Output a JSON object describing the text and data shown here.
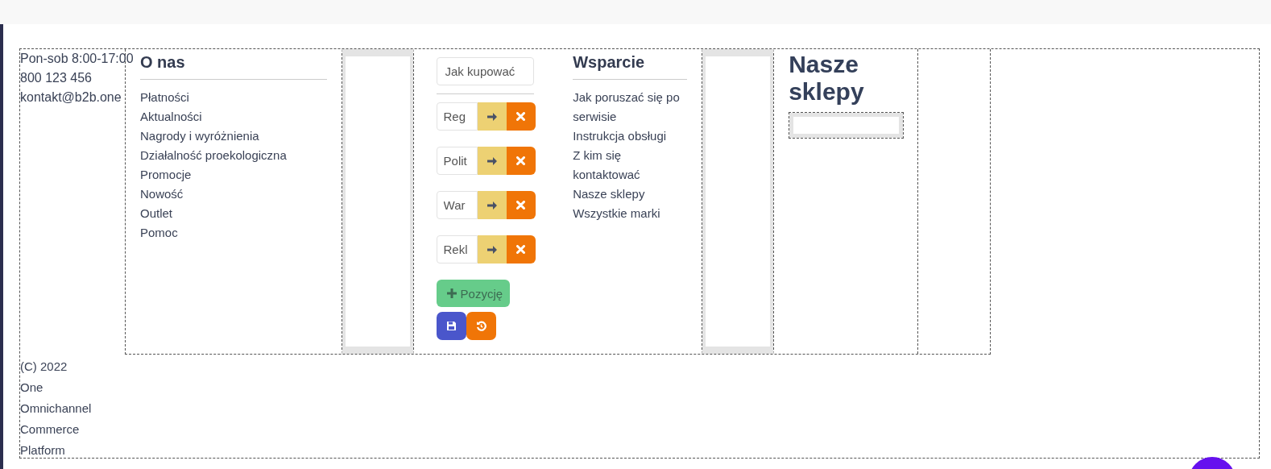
{
  "contact": [
    "Pon-sob 8:00-17:00",
    "800 123 456",
    "kontakt@b2b.one"
  ],
  "about": {
    "title": "O nas",
    "links": [
      "Płatności",
      "Aktualności",
      "Nagrody i wyróżnienia",
      "Działalność proekologiczna",
      "Promocje",
      "Nowość",
      "Outlet",
      "Pomoc"
    ]
  },
  "editor": {
    "main_field": {
      "value": "Jak kupować"
    },
    "items": [
      {
        "value": "Reg"
      },
      {
        "value": "Polit"
      },
      {
        "value": "War"
      },
      {
        "value": "Rekl"
      }
    ],
    "add_button": "Pozycję"
  },
  "support": {
    "title": "Wsparcie",
    "links": [
      "Jak poruszać się po serwisie",
      "Instrukcja obsługi",
      "Z kim się kontaktować",
      "Nasze sklepy",
      "Wszystkie marki"
    ]
  },
  "stores": {
    "title": "Nasze sklepy"
  },
  "copyright": "(C) 2022 One Omnichannel Commerce Platform"
}
